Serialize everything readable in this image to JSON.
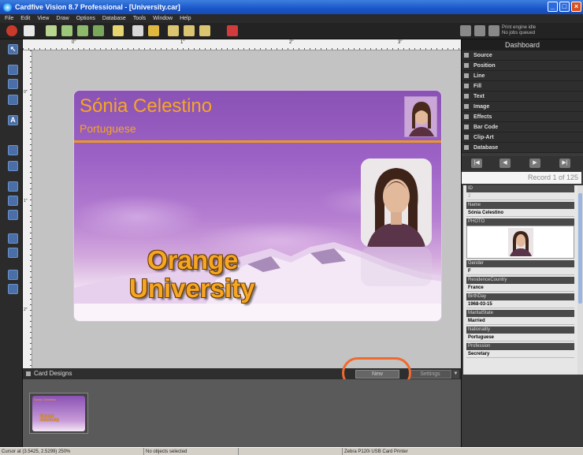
{
  "window": {
    "title": "Cardfive Vision 8.7 Professional - [University.car]"
  },
  "menu": [
    "File",
    "Edit",
    "View",
    "Draw",
    "Options",
    "Database",
    "Tools",
    "Window",
    "Help"
  ],
  "toolbar": {
    "print_status_line1": "Print engine idle",
    "print_status_line2": "No jobs queued"
  },
  "ruler": {
    "top_labels": [
      "0\"",
      "1\"",
      "2\"",
      "3\""
    ],
    "left_labels": [
      "0\"",
      "1\"",
      "2\""
    ]
  },
  "card": {
    "name": "Sónia Celestino",
    "nationality": "Portuguese",
    "university_line1": "Orange",
    "university_line2": "University"
  },
  "dashboard": {
    "title": "Dashboard",
    "sections": [
      "Source",
      "Position",
      "Line",
      "Fill",
      "Text",
      "Image",
      "Effects",
      "Bar Code",
      "Clip-Art",
      "Database"
    ],
    "record_label": "Record 1 of 125",
    "fields": [
      {
        "label": "ID",
        "value": "2",
        "muted": true
      },
      {
        "label": "Name",
        "value": "Sónia Celestino"
      },
      {
        "label": "PHOTO",
        "value": ""
      },
      {
        "label": "Gender",
        "value": "F"
      },
      {
        "label": "ResidenceCountry",
        "value": "France"
      },
      {
        "label": "BirthDay",
        "value": "1968-03-15"
      },
      {
        "label": "MaritalState",
        "value": "Married"
      },
      {
        "label": "Nationality",
        "value": "Portuguese"
      },
      {
        "label": "Profession",
        "value": "Secretary"
      }
    ]
  },
  "card_designs": {
    "title": "Card Designs",
    "new_label": "New",
    "settings_label": "Settings",
    "thumb_name": "Sónia Celestino",
    "thumb_uni1": "Orange",
    "thumb_uni2": "University"
  },
  "status": {
    "cursor": "Cursor at (3.5425, 2.5299) 250%",
    "selection": "No objects selected",
    "printer": "Zebra P120i USB Card Printer"
  },
  "colors": {
    "accent_orange": "#f6a623",
    "highlight_ring": "#ef6a2f"
  }
}
